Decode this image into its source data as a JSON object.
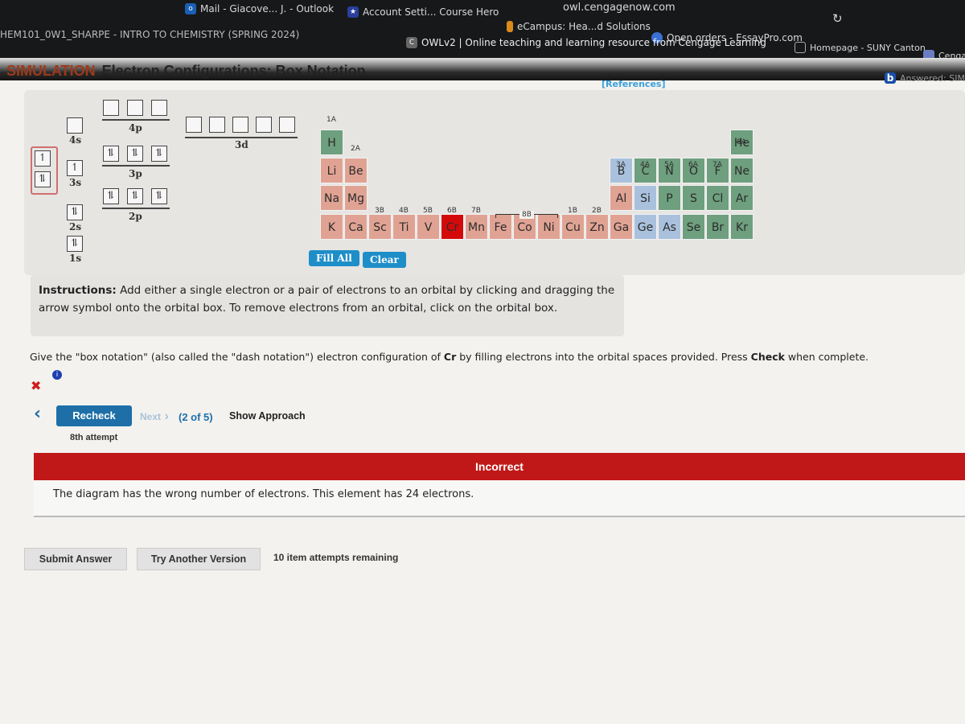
{
  "browser": {
    "url": "owl.cengagenow.com",
    "tab_title": "HEM101_0W1_SHARPE - INTRO TO CHEMISTRY (SPRING 2024)",
    "page_title": "OWLv2 | Online teaching and learning resource from Cengage Learning",
    "bookmarks": [
      "Mail - Giacove... J. - Outlook",
      "Account Setti... Course Hero",
      "eCampus: Hea...d Solutions",
      "Open orders - EssayPro.com",
      "Homepage - SUNY Canton",
      "Cengag"
    ],
    "answered_tab": "Answered: SIMUL",
    "references": "[References]"
  },
  "header": {
    "tag": "SIMULATION",
    "title": "Electron Configurations: Box Notation"
  },
  "orbitals": {
    "drag_source": [
      "↿",
      "⥮"
    ],
    "s": [
      {
        "label": "4s",
        "boxes": [
          ""
        ]
      },
      {
        "label": "3s",
        "boxes": [
          "↿"
        ]
      },
      {
        "label": "2s",
        "boxes": [
          "⥮"
        ]
      },
      {
        "label": "1s",
        "boxes": [
          "⥮"
        ]
      }
    ],
    "p": [
      {
        "label": "4p",
        "boxes": [
          "",
          "",
          ""
        ]
      },
      {
        "label": "3p",
        "boxes": [
          "⥮",
          "⥮",
          "⥮"
        ]
      },
      {
        "label": "2p",
        "boxes": [
          "⥮",
          "⥮",
          "⥮"
        ]
      }
    ],
    "d": [
      {
        "label": "3d",
        "boxes": [
          "",
          "",
          "",
          "",
          ""
        ]
      }
    ]
  },
  "periodic_table": {
    "colors": {
      "metal": "#e0a393",
      "nonmetal": "#6e9f7e",
      "metalloid": "#a9c1dd",
      "selected": "#d40a0a"
    },
    "selected": "Cr",
    "group_labels_a": [
      "1A",
      "2A",
      "3A",
      "4A",
      "5A",
      "6A",
      "7A",
      "8A"
    ],
    "group_labels_b": [
      "3B",
      "4B",
      "5B",
      "6B",
      "7B",
      "8B",
      "1B",
      "2B"
    ],
    "elements": [
      {
        "s": "H",
        "p": 1,
        "g": 1,
        "c": "nonmetal"
      },
      {
        "s": "He",
        "p": 1,
        "g": 18,
        "c": "nonmetal"
      },
      {
        "s": "Li",
        "p": 2,
        "g": 1,
        "c": "metal"
      },
      {
        "s": "Be",
        "p": 2,
        "g": 2,
        "c": "metal"
      },
      {
        "s": "B",
        "p": 2,
        "g": 13,
        "c": "metalloid"
      },
      {
        "s": "C",
        "p": 2,
        "g": 14,
        "c": "nonmetal"
      },
      {
        "s": "N",
        "p": 2,
        "g": 15,
        "c": "nonmetal"
      },
      {
        "s": "O",
        "p": 2,
        "g": 16,
        "c": "nonmetal"
      },
      {
        "s": "F",
        "p": 2,
        "g": 17,
        "c": "nonmetal"
      },
      {
        "s": "Ne",
        "p": 2,
        "g": 18,
        "c": "nonmetal"
      },
      {
        "s": "Na",
        "p": 3,
        "g": 1,
        "c": "metal"
      },
      {
        "s": "Mg",
        "p": 3,
        "g": 2,
        "c": "metal"
      },
      {
        "s": "Al",
        "p": 3,
        "g": 13,
        "c": "metal"
      },
      {
        "s": "Si",
        "p": 3,
        "g": 14,
        "c": "metalloid"
      },
      {
        "s": "P",
        "p": 3,
        "g": 15,
        "c": "nonmetal"
      },
      {
        "s": "S",
        "p": 3,
        "g": 16,
        "c": "nonmetal"
      },
      {
        "s": "Cl",
        "p": 3,
        "g": 17,
        "c": "nonmetal"
      },
      {
        "s": "Ar",
        "p": 3,
        "g": 18,
        "c": "nonmetal"
      },
      {
        "s": "K",
        "p": 4,
        "g": 1,
        "c": "metal"
      },
      {
        "s": "Ca",
        "p": 4,
        "g": 2,
        "c": "metal"
      },
      {
        "s": "Sc",
        "p": 4,
        "g": 3,
        "c": "metal"
      },
      {
        "s": "Ti",
        "p": 4,
        "g": 4,
        "c": "metal"
      },
      {
        "s": "V",
        "p": 4,
        "g": 5,
        "c": "metal"
      },
      {
        "s": "Cr",
        "p": 4,
        "g": 6,
        "c": "metal"
      },
      {
        "s": "Mn",
        "p": 4,
        "g": 7,
        "c": "metal"
      },
      {
        "s": "Fe",
        "p": 4,
        "g": 8,
        "c": "metal"
      },
      {
        "s": "Co",
        "p": 4,
        "g": 9,
        "c": "metal"
      },
      {
        "s": "Ni",
        "p": 4,
        "g": 10,
        "c": "metal"
      },
      {
        "s": "Cu",
        "p": 4,
        "g": 11,
        "c": "metal"
      },
      {
        "s": "Zn",
        "p": 4,
        "g": 12,
        "c": "metal"
      },
      {
        "s": "Ga",
        "p": 4,
        "g": 13,
        "c": "metal"
      },
      {
        "s": "Ge",
        "p": 4,
        "g": 14,
        "c": "metalloid"
      },
      {
        "s": "As",
        "p": 4,
        "g": 15,
        "c": "metalloid"
      },
      {
        "s": "Se",
        "p": 4,
        "g": 16,
        "c": "nonmetal"
      },
      {
        "s": "Br",
        "p": 4,
        "g": 17,
        "c": "nonmetal"
      },
      {
        "s": "Kr",
        "p": 4,
        "g": 18,
        "c": "nonmetal"
      }
    ],
    "fill_all": "Fill All",
    "clear": "Clear"
  },
  "instructions": {
    "label": "Instructions:",
    "text": " Add either a single electron or a pair of electrons to an orbital by clicking and dragging the arrow symbol onto the orbital box. To remove electrons from an orbital, click on the orbital box."
  },
  "question": {
    "pre": "Give the \"box notation\" (also called the \"dash notation\") electron configuration of ",
    "element": "Cr",
    "mid": " by filling electrons into the orbital spaces provided. Press ",
    "check": "Check",
    "post": " when complete."
  },
  "nav": {
    "recheck": "Recheck",
    "next": "Next",
    "progress": "(2 of 5)",
    "show_approach": "Show Approach",
    "attempt": "8th attempt"
  },
  "feedback": {
    "status": "Incorrect",
    "message": "The diagram has the wrong number of electrons. This element has 24 electrons."
  },
  "footer": {
    "submit": "Submit Answer",
    "try_another": "Try Another Version",
    "remaining": "10 item attempts remaining"
  }
}
